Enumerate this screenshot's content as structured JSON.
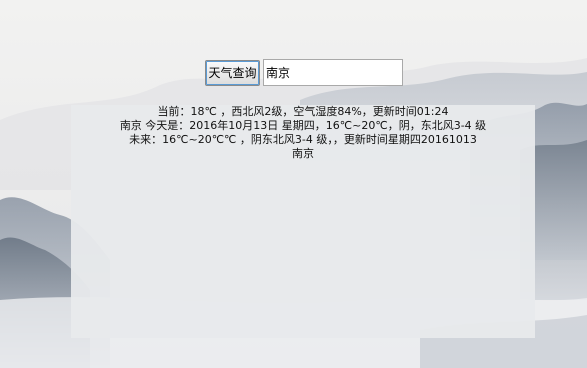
{
  "search": {
    "button_label": "天气查询",
    "input_value": "南京"
  },
  "weather": {
    "current_line": "当前：18℃ ，西北风2级，空气湿度84%，更新时间01:24",
    "today_line": "南京 今天是：2016年10月13日 星期四，16℃~20℃，阴，东北风3-4 级",
    "future_line": "未来：16℃~20℃℃ ，阴东北风3-4 级，，更新时间星期四20161013",
    "city_line": "南京"
  }
}
